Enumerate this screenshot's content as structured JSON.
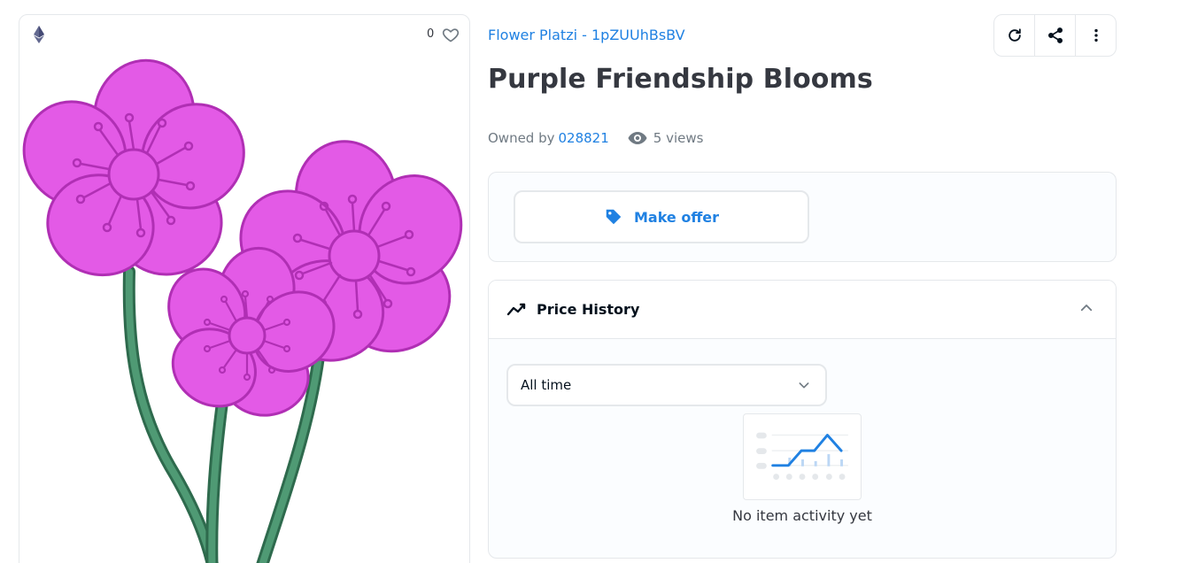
{
  "card": {
    "favorites_count": "0",
    "icons": {
      "chain": "ethereum-icon",
      "favorite": "heart-icon"
    }
  },
  "header": {
    "collection_link": "Flower Platzi - 1pZUUhBsBV",
    "title": "Purple Friendship Blooms",
    "actions": [
      "refresh-icon",
      "share-icon",
      "more-vertical-icon"
    ]
  },
  "meta": {
    "owned_by_label": "Owned by",
    "owner": "028821",
    "views": "5 views"
  },
  "offer": {
    "button_label": "Make offer",
    "icon": "tag-icon"
  },
  "price_history": {
    "title": "Price History",
    "period_selected": "All time",
    "empty_message": "No item activity yet"
  },
  "colors": {
    "accent": "#2081e2",
    "text": "#353840",
    "muted": "#707a83",
    "border": "#e5e8eb",
    "petal": "#e35ae6",
    "petal_stroke": "#b02fb4",
    "stem": "#4a8a6a"
  }
}
